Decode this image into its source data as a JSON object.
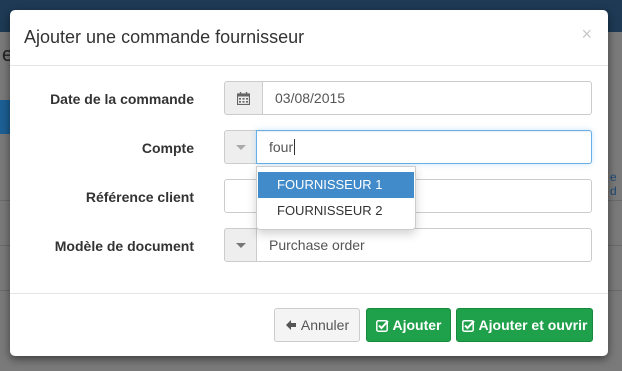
{
  "modal": {
    "title": "Ajouter une commande fournisseur",
    "close_glyph": "×"
  },
  "form": {
    "date": {
      "label": "Date de la commande",
      "value": "03/08/2015",
      "icon": "calendar-icon"
    },
    "account": {
      "label": "Compte",
      "value": "four",
      "icon": "caret-down-icon"
    },
    "client_reference": {
      "label": "Référence client",
      "value": ""
    },
    "document_model": {
      "label": "Modèle de document",
      "value": "Purchase order",
      "icon": "caret-down-icon"
    }
  },
  "account_suggestions": [
    {
      "label": "FOURNISSEUR 1",
      "active": true
    },
    {
      "label": "FOURNISSEUR 2",
      "active": false
    }
  ],
  "footer": {
    "cancel_label": "Annuler",
    "add_label": "Ajouter",
    "add_open_label": "Ajouter et ouvrir"
  },
  "background": {
    "left_letter": "e",
    "right_link": "e d"
  },
  "colors": {
    "primary": "#428bca",
    "success": "#1fa04a",
    "focus_border": "#66afe9"
  }
}
